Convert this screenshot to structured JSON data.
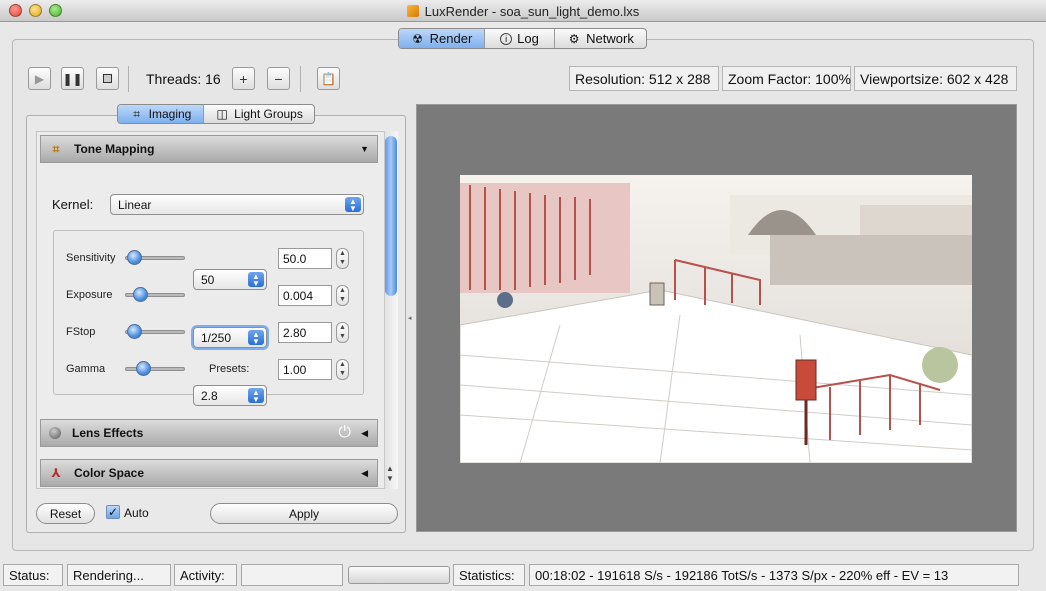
{
  "window": {
    "title": "LuxRender - soa_sun_light_demo.lxs"
  },
  "main_tabs": [
    {
      "label": "Render",
      "icon": "radiation-icon",
      "active": true
    },
    {
      "label": "Log",
      "icon": "info-icon",
      "active": false
    },
    {
      "label": "Network",
      "icon": "network-icon",
      "active": false
    }
  ],
  "toolbar": {
    "threads_label": "Threads: 16",
    "resolution": "Resolution: 512 x 288",
    "zoom": "Zoom Factor: 100%",
    "viewport": "Viewportsize: 602 x 428"
  },
  "side_tabs": [
    {
      "label": "Imaging",
      "active": true
    },
    {
      "label": "Light Groups",
      "active": false
    }
  ],
  "tone_mapping": {
    "header": "Tone Mapping",
    "kernel_label": "Kernel:",
    "kernel_value": "Linear",
    "sensitivity": {
      "label": "Sensitivity",
      "preset": "50",
      "value": "50.0"
    },
    "exposure": {
      "label": "Exposure",
      "preset": "1/250",
      "value": "0.004"
    },
    "fstop": {
      "label": "FStop",
      "preset": "2.8",
      "value": "2.80"
    },
    "gamma": {
      "label": "Gamma",
      "presets_label": "Presets:",
      "value": "1.00"
    }
  },
  "lens_effects": {
    "header": "Lens Effects"
  },
  "color_space": {
    "header": "Color Space"
  },
  "bottom_buttons": {
    "reset": "Reset",
    "auto": "Auto",
    "auto_checked": true,
    "apply": "Apply"
  },
  "statusbar": {
    "status_label": "Status:",
    "status_value": "Rendering...",
    "activity_label": "Activity:",
    "statistics_label": "Statistics:",
    "statistics_value": "00:18:02 - 191618 S/s - 192186 TotS/s - 1373 S/px - 220% eff - EV = 13"
  },
  "colors": {
    "accent": "#3d7fe0",
    "render_bg": "#7a7a7a"
  }
}
